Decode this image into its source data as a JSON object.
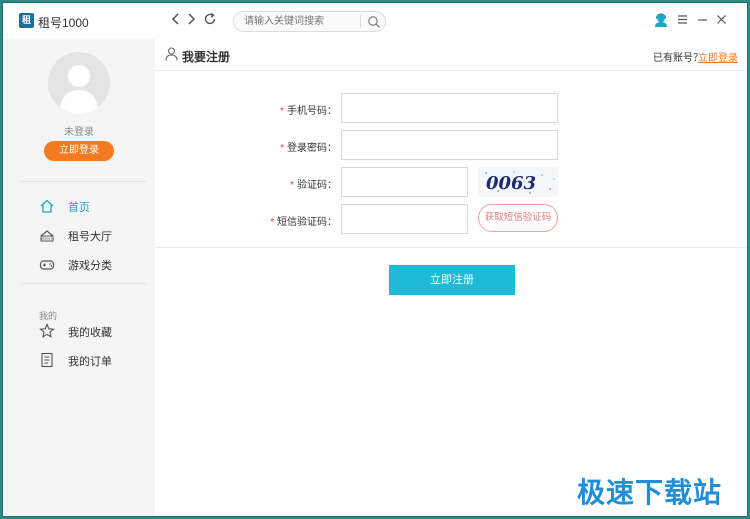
{
  "titlebar": {
    "app_name": "租号1000",
    "app_logo_text": "租",
    "back_label": "<",
    "forward_label": ">",
    "refresh_label": "↻",
    "search_placeholder": "请输入关键词搜索",
    "icons": [
      "user-service-icon",
      "menu-icon",
      "minimize-icon",
      "close-icon"
    ]
  },
  "sidebar": {
    "login_status": "未登录",
    "login_button": "立即登录",
    "nav": [
      {
        "label": "首页",
        "icon": "home-icon",
        "active": true
      },
      {
        "label": "租号大厅",
        "icon": "rent-icon",
        "active": false
      },
      {
        "label": "游戏分类",
        "icon": "gamepad-icon",
        "active": false
      }
    ],
    "section_label": "我的",
    "my_nav": [
      {
        "label": "我的收藏",
        "icon": "star-icon"
      },
      {
        "label": "我的订单",
        "icon": "order-icon"
      }
    ]
  },
  "main": {
    "title": "我要注册",
    "have_account": "已有账号？",
    "login_link": "立即登录",
    "form": {
      "phone_label": "手机号码：",
      "password_label": "登录密码：",
      "captcha_label": "验证码：",
      "captcha_text": "0063",
      "sms_label": "短信验证码：",
      "sms_button": "获取短信验证码",
      "required_mark": "*"
    },
    "submit_button": "立即注册"
  },
  "watermark": "极速下载站",
  "colors": {
    "accent": "#1fbad6",
    "orange": "#f47a20",
    "frame": "#2e8b84",
    "nav_active": "#1aa7c8"
  }
}
